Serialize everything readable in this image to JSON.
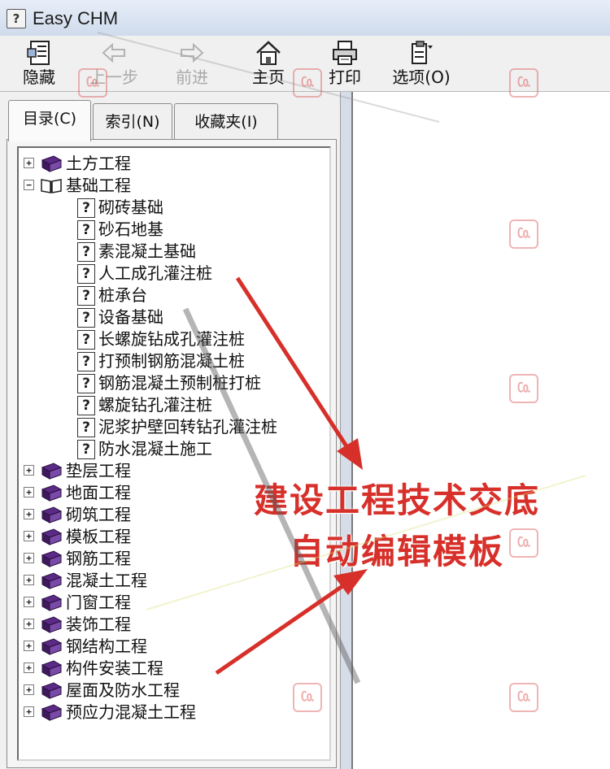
{
  "window": {
    "title": "Easy CHM"
  },
  "toolbar": {
    "buttons": [
      {
        "label": "隐藏",
        "icon": "hide-pane-icon",
        "enabled": true
      },
      {
        "label": "上一步",
        "icon": "back-arrow-icon",
        "enabled": false
      },
      {
        "label": "前进",
        "icon": "forward-arrow-icon",
        "enabled": false
      },
      {
        "label": "主页",
        "icon": "home-icon",
        "enabled": true
      },
      {
        "label": "打印",
        "icon": "printer-icon",
        "enabled": true
      },
      {
        "label": "选项(O)",
        "icon": "options-icon",
        "enabled": true
      }
    ]
  },
  "tabs": [
    {
      "label": "目录(C)",
      "active": true
    },
    {
      "label": "索引(N)",
      "active": false
    },
    {
      "label": "收藏夹(I)",
      "active": false
    }
  ],
  "tree": [
    {
      "label": "土方工程",
      "type": "book",
      "expanded": false,
      "level": 0
    },
    {
      "label": "基础工程",
      "type": "book",
      "expanded": true,
      "level": 0
    },
    {
      "label": "砌砖基础",
      "type": "page",
      "level": 1
    },
    {
      "label": "砂石地基",
      "type": "page",
      "level": 1
    },
    {
      "label": "素混凝土基础",
      "type": "page",
      "level": 1
    },
    {
      "label": "人工成孔灌注桩",
      "type": "page",
      "level": 1
    },
    {
      "label": "桩承台",
      "type": "page",
      "level": 1
    },
    {
      "label": "设备基础",
      "type": "page",
      "level": 1
    },
    {
      "label": "长螺旋钻成孔灌注桩",
      "type": "page",
      "level": 1
    },
    {
      "label": "打预制钢筋混凝土桩",
      "type": "page",
      "level": 1
    },
    {
      "label": "钢筋混凝土预制桩打桩",
      "type": "page",
      "level": 1
    },
    {
      "label": "螺旋钻孔灌注桩",
      "type": "page",
      "level": 1
    },
    {
      "label": "泥浆护壁回转钻孔灌注桩",
      "type": "page",
      "level": 1
    },
    {
      "label": "防水混凝土施工",
      "type": "page",
      "level": 1
    },
    {
      "label": "垫层工程",
      "type": "book",
      "expanded": false,
      "level": 0
    },
    {
      "label": "地面工程",
      "type": "book",
      "expanded": false,
      "level": 0
    },
    {
      "label": "砌筑工程",
      "type": "book",
      "expanded": false,
      "level": 0
    },
    {
      "label": "模板工程",
      "type": "book",
      "expanded": false,
      "level": 0
    },
    {
      "label": "钢筋工程",
      "type": "book",
      "expanded": false,
      "level": 0
    },
    {
      "label": "混凝土工程",
      "type": "book",
      "expanded": false,
      "level": 0
    },
    {
      "label": "门窗工程",
      "type": "book",
      "expanded": false,
      "level": 0
    },
    {
      "label": "装饰工程",
      "type": "book",
      "expanded": false,
      "level": 0
    },
    {
      "label": "钢结构工程",
      "type": "book",
      "expanded": false,
      "level": 0
    },
    {
      "label": "构件安装工程",
      "type": "book",
      "expanded": false,
      "level": 0
    },
    {
      "label": "屋面及防水工程",
      "type": "book",
      "expanded": false,
      "level": 0
    },
    {
      "label": "预应力混凝土工程",
      "type": "book",
      "expanded": false,
      "level": 0
    }
  ],
  "caption": {
    "line1": "建设工程技术交底",
    "line2": "自动编辑模板"
  },
  "colors": {
    "book": "#5b2a86",
    "caption": "#d7302a",
    "arrow": "#d7302a",
    "toolbar_bg": "#f0f0f0",
    "title_bg": "#dbe4f1"
  }
}
